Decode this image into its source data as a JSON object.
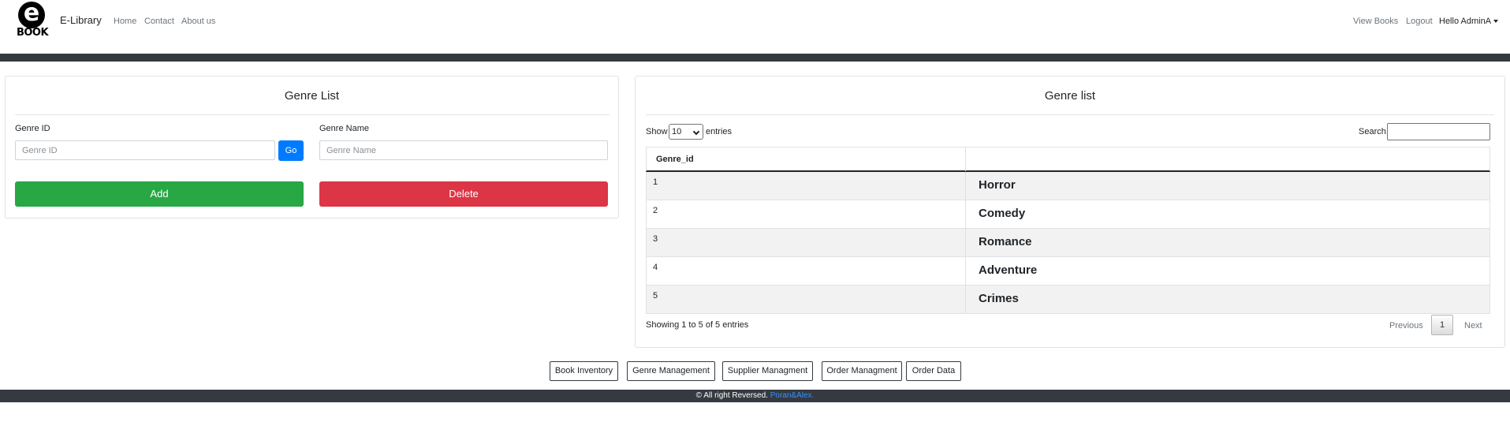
{
  "navbar": {
    "logo_letter": "e",
    "logo_word": "BOOK",
    "brand": "E-Library",
    "links": [
      "Home",
      "Contact",
      "About us"
    ],
    "right_links": [
      "View Books",
      "Logout"
    ],
    "user": "Hello AdminA"
  },
  "form_card": {
    "title": "Genre List",
    "genre_id_label": "Genre ID",
    "genre_id_placeholder": "Genre ID",
    "go_label": "Go",
    "genre_name_label": "Genre Name",
    "genre_name_placeholder": "Genre Name",
    "add_label": "Add",
    "delete_label": "Delete"
  },
  "table_card": {
    "title": "Genre list",
    "show_label": "Show",
    "entries_value": "10",
    "entries_label": "entries",
    "search_label": "Search:",
    "columns": [
      "Genre_id",
      ""
    ],
    "rows": [
      {
        "id": "1",
        "name": "Horror"
      },
      {
        "id": "2",
        "name": "Comedy"
      },
      {
        "id": "3",
        "name": "Romance"
      },
      {
        "id": "4",
        "name": "Adventure"
      },
      {
        "id": "5",
        "name": "Crimes"
      }
    ],
    "info": "Showing 1 to 5 of 5 entries",
    "previous": "Previous",
    "page": "1",
    "next": "Next"
  },
  "footer_nav": [
    "Book Inventory",
    "Genre Management",
    "Supplier Managment",
    "Order Managment",
    "Order Data"
  ],
  "footer": {
    "text": "© All right Reversed.",
    "link": "Poran&Alex."
  }
}
